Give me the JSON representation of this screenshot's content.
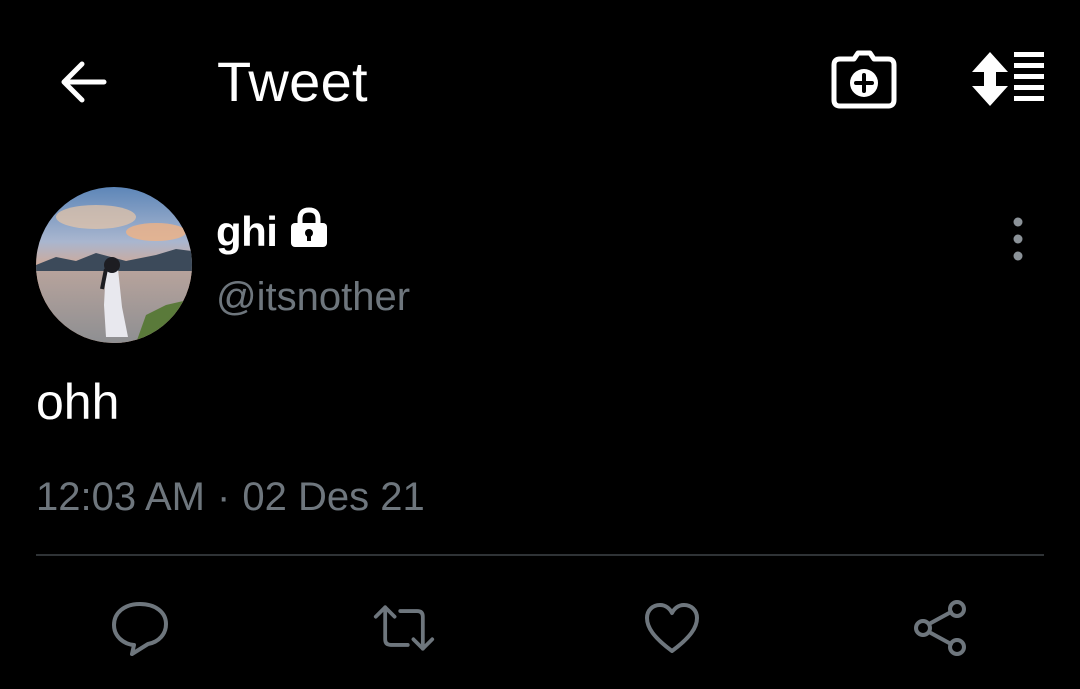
{
  "header": {
    "title": "Tweet",
    "back_icon": "arrow-left-icon",
    "camera_icon": "camera-plus-icon",
    "sort_icon": "sort-list-icon"
  },
  "tweet": {
    "author": {
      "display_name": "ghi",
      "handle": "@itsnother",
      "protected": true,
      "lock_icon": "lock-icon"
    },
    "text": "ohh",
    "time": "12:03 AM",
    "separator": "·",
    "date": "02 Des 21"
  },
  "actions": {
    "reply_icon": "reply-icon",
    "retweet_icon": "retweet-icon",
    "like_icon": "heart-icon",
    "share_icon": "share-icon"
  },
  "colors": {
    "background": "#000000",
    "primary_text": "#ffffff",
    "secondary_text": "#6e767d",
    "divider": "#2f3336"
  }
}
